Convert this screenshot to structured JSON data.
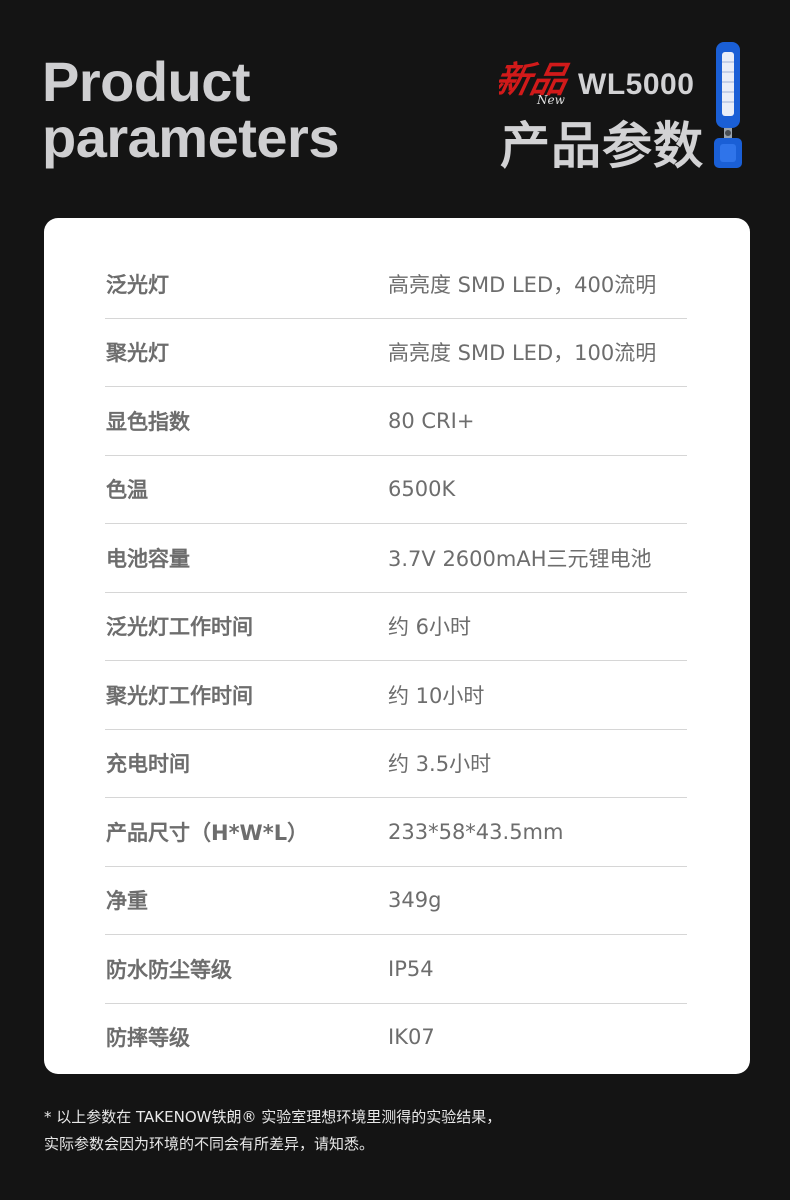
{
  "header": {
    "title_en_line1": "Product",
    "title_en_line2": "parameters",
    "new_badge": "新品",
    "new_badge_sub": "New",
    "model": "WL5000",
    "title_cn": "产品参数"
  },
  "colors": {
    "background": "#141414",
    "card": "#ffffff",
    "title_text": "#cfcfd1",
    "spec_text": "#6d6d6d",
    "divider": "#d6d6d6",
    "badge_red": "#d11a1a",
    "product_blue": "#1a5fd6"
  },
  "specs": [
    {
      "label": "泛光灯",
      "value": "高亮度 SMD LED，400流明"
    },
    {
      "label": "聚光灯",
      "value": "高亮度 SMD LED，100流明"
    },
    {
      "label": "显色指数",
      "value": "80 CRI+"
    },
    {
      "label": "色温",
      "value": "6500K"
    },
    {
      "label": "电池容量",
      "value": "3.7V 2600mAH三元锂电池"
    },
    {
      "label": "泛光灯工作时间",
      "value": "约 6小时"
    },
    {
      "label": "聚光灯工作时间",
      "value": "约 10小时"
    },
    {
      "label": "充电时间",
      "value": "约 3.5小时"
    },
    {
      "label": "产品尺寸（H*W*L）",
      "value": "233*58*43.5mm"
    },
    {
      "label": "净重",
      "value": "349g"
    },
    {
      "label": "防水防尘等级",
      "value": "IP54"
    },
    {
      "label": "防摔等级",
      "value": "IK07"
    }
  ],
  "footnote": {
    "line1": "* 以上参数在 TAKENOW铁朗® 实验室理想环境里测得的实验结果，",
    "line2": "实际参数会因为环境的不同会有所差异，请知悉。"
  }
}
